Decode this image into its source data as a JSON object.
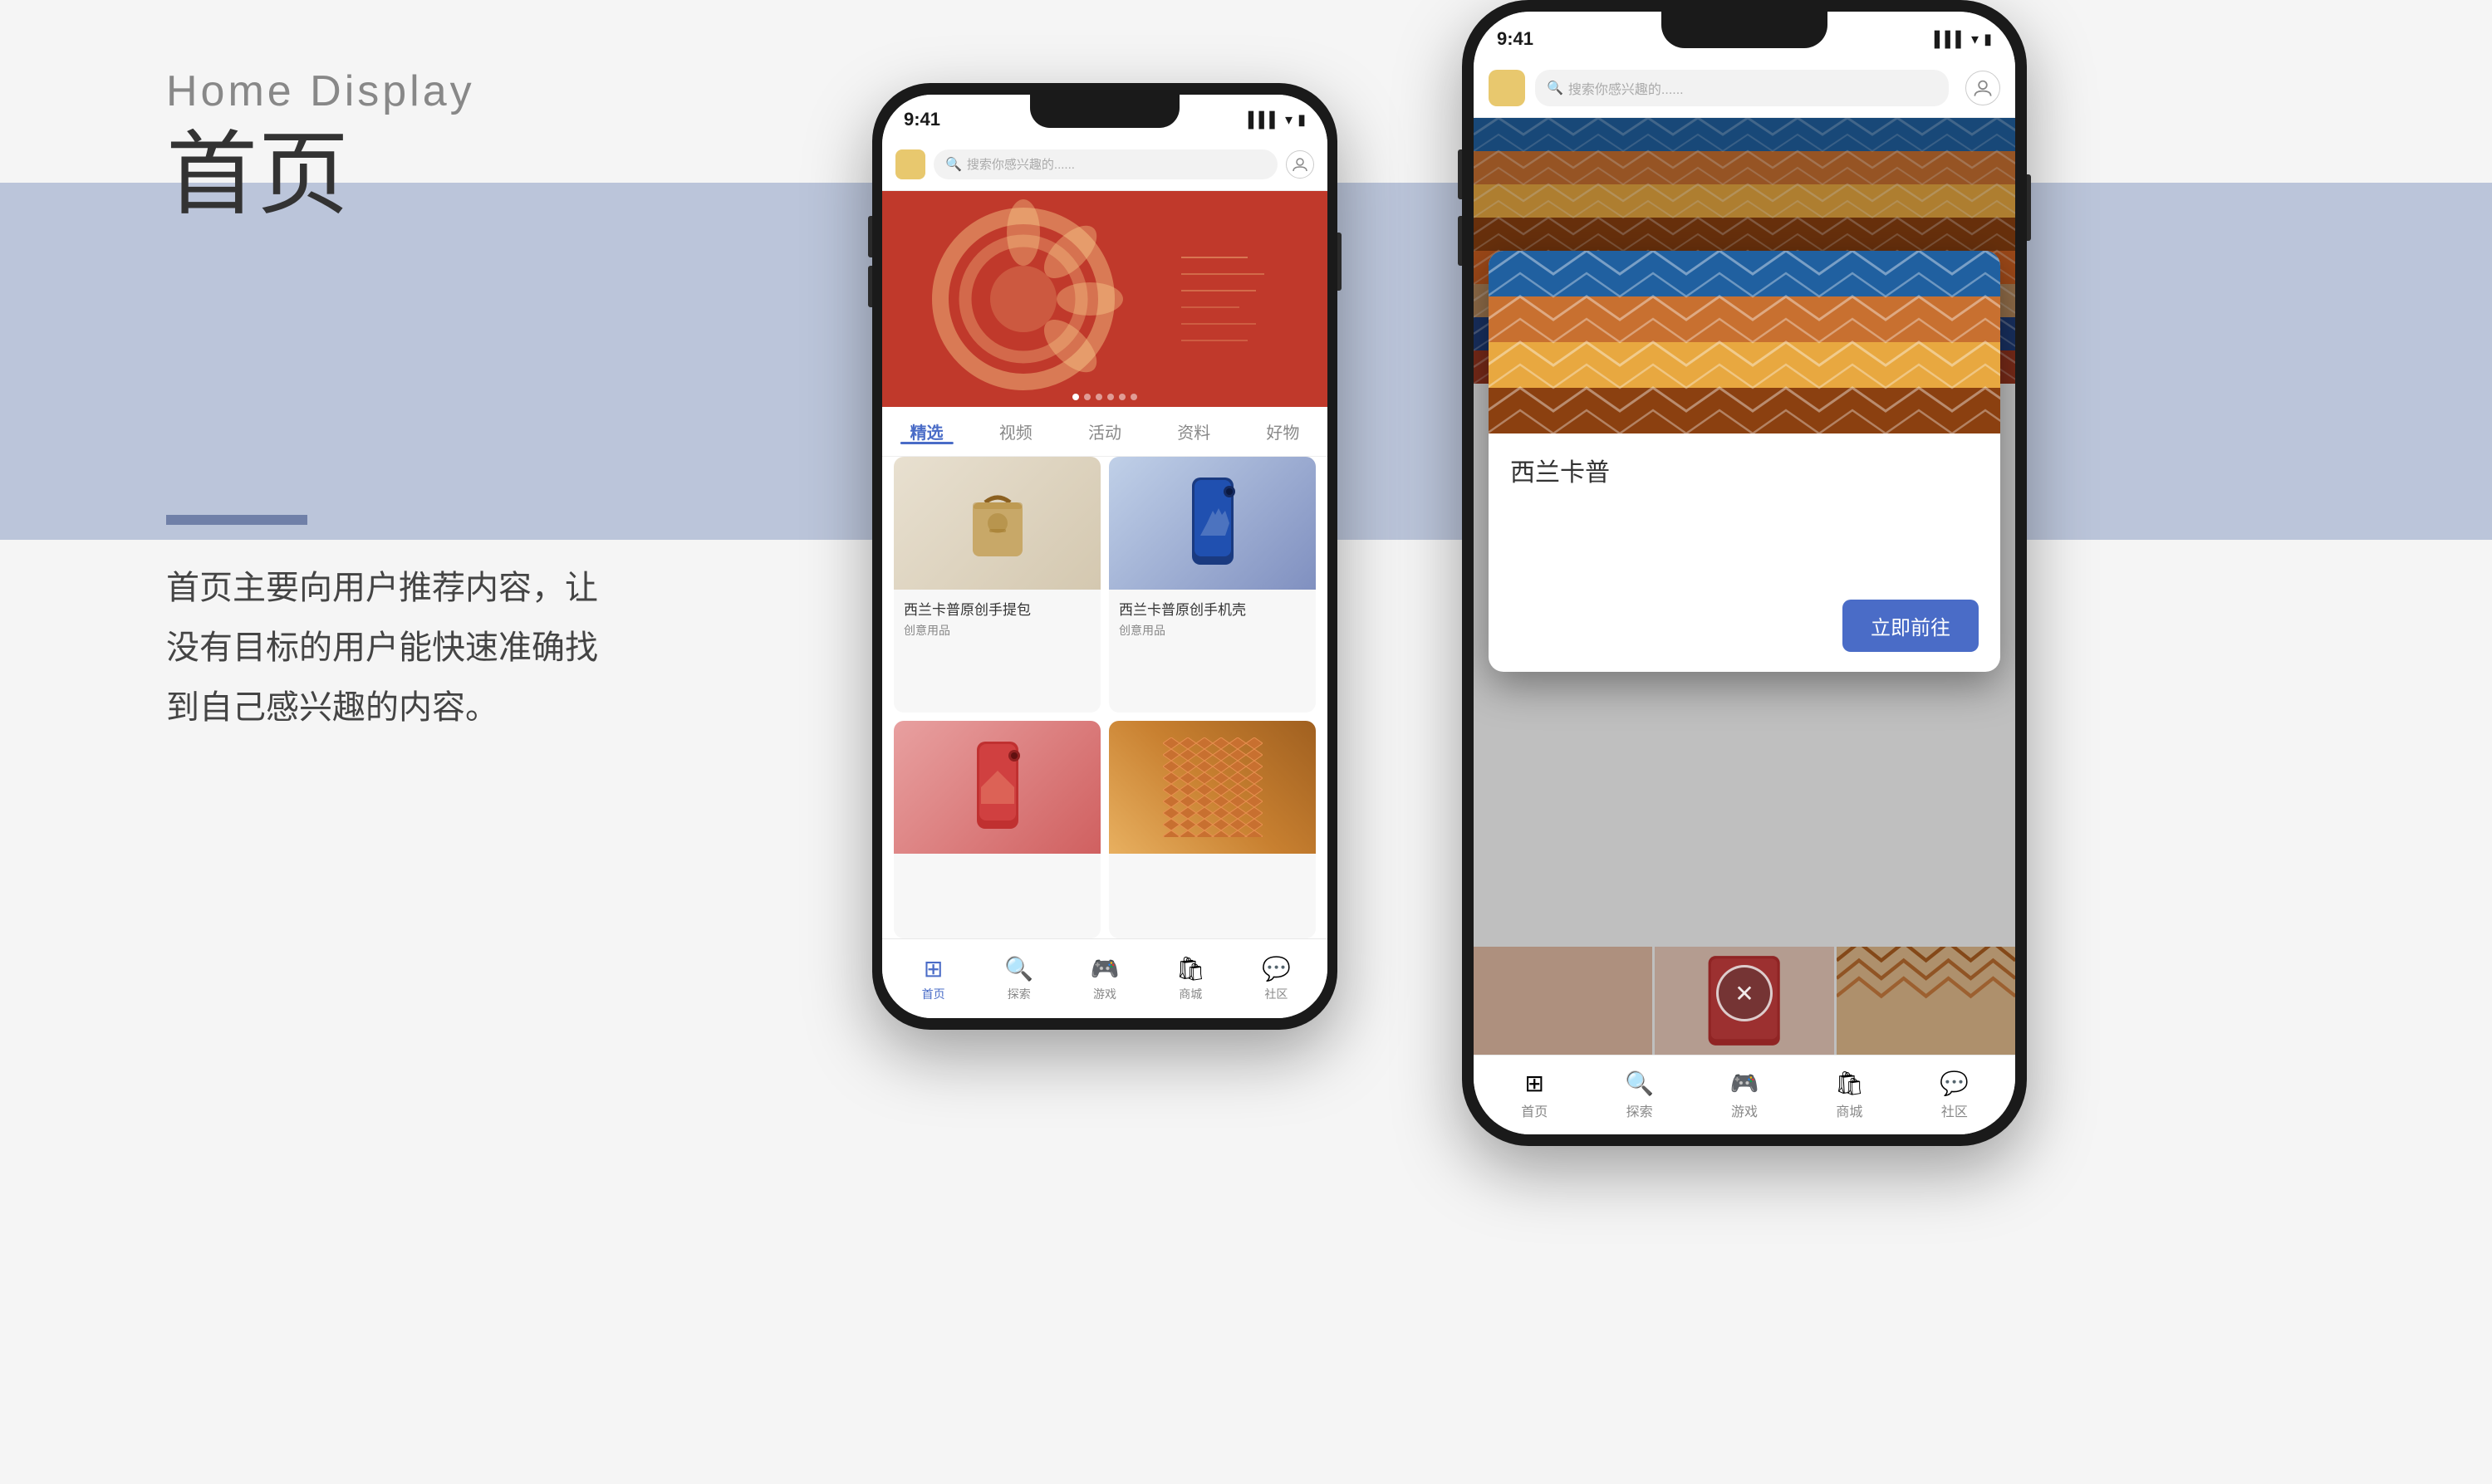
{
  "page": {
    "background": "#f5f5f5",
    "blue_band_color": "#8b9dc3"
  },
  "left": {
    "label_en": "Home  Display",
    "label_zh": "首页",
    "desc_text": "首页主要向用户推荐内容，让没有目标的用户能快速准确找到自己感兴趣的内容。"
  },
  "phone1": {
    "status_time": "9:41",
    "status_icons": "▌▌ ▾ ▮",
    "search_placeholder": "搜索你感兴趣的......",
    "tabs": [
      "精选",
      "视频",
      "活动",
      "资料",
      "好物"
    ],
    "active_tab": 0,
    "products": [
      {
        "name": "西兰卡普原创手提包",
        "sub": "创意用品"
      },
      {
        "name": "西兰卡普原创手机壳",
        "sub": "创意用品"
      },
      {
        "name": "",
        "sub": ""
      },
      {
        "name": "",
        "sub": ""
      }
    ],
    "nav_items": [
      {
        "label": "首页",
        "icon": "⊞",
        "active": true
      },
      {
        "label": "探索",
        "icon": "🔍",
        "active": false
      },
      {
        "label": "游戏",
        "icon": "🎮",
        "active": false
      },
      {
        "label": "商城",
        "icon": "🛍",
        "active": false
      },
      {
        "label": "社区",
        "icon": "💬",
        "active": false
      }
    ]
  },
  "phone2": {
    "status_time": "9:41",
    "search_placeholder": "搜索你感兴趣的......",
    "modal": {
      "title": "西兰卡普",
      "btn_label": "立即前往",
      "close_icon": "✕"
    },
    "nav_items": [
      {
        "label": "首页",
        "icon": "⊞",
        "active": false
      },
      {
        "label": "探索",
        "icon": "🔍",
        "active": false
      },
      {
        "label": "游戏",
        "icon": "🎮",
        "active": false
      },
      {
        "label": "商城",
        "icon": "🛍",
        "active": false
      },
      {
        "label": "社区",
        "icon": "💬",
        "active": false
      }
    ]
  }
}
